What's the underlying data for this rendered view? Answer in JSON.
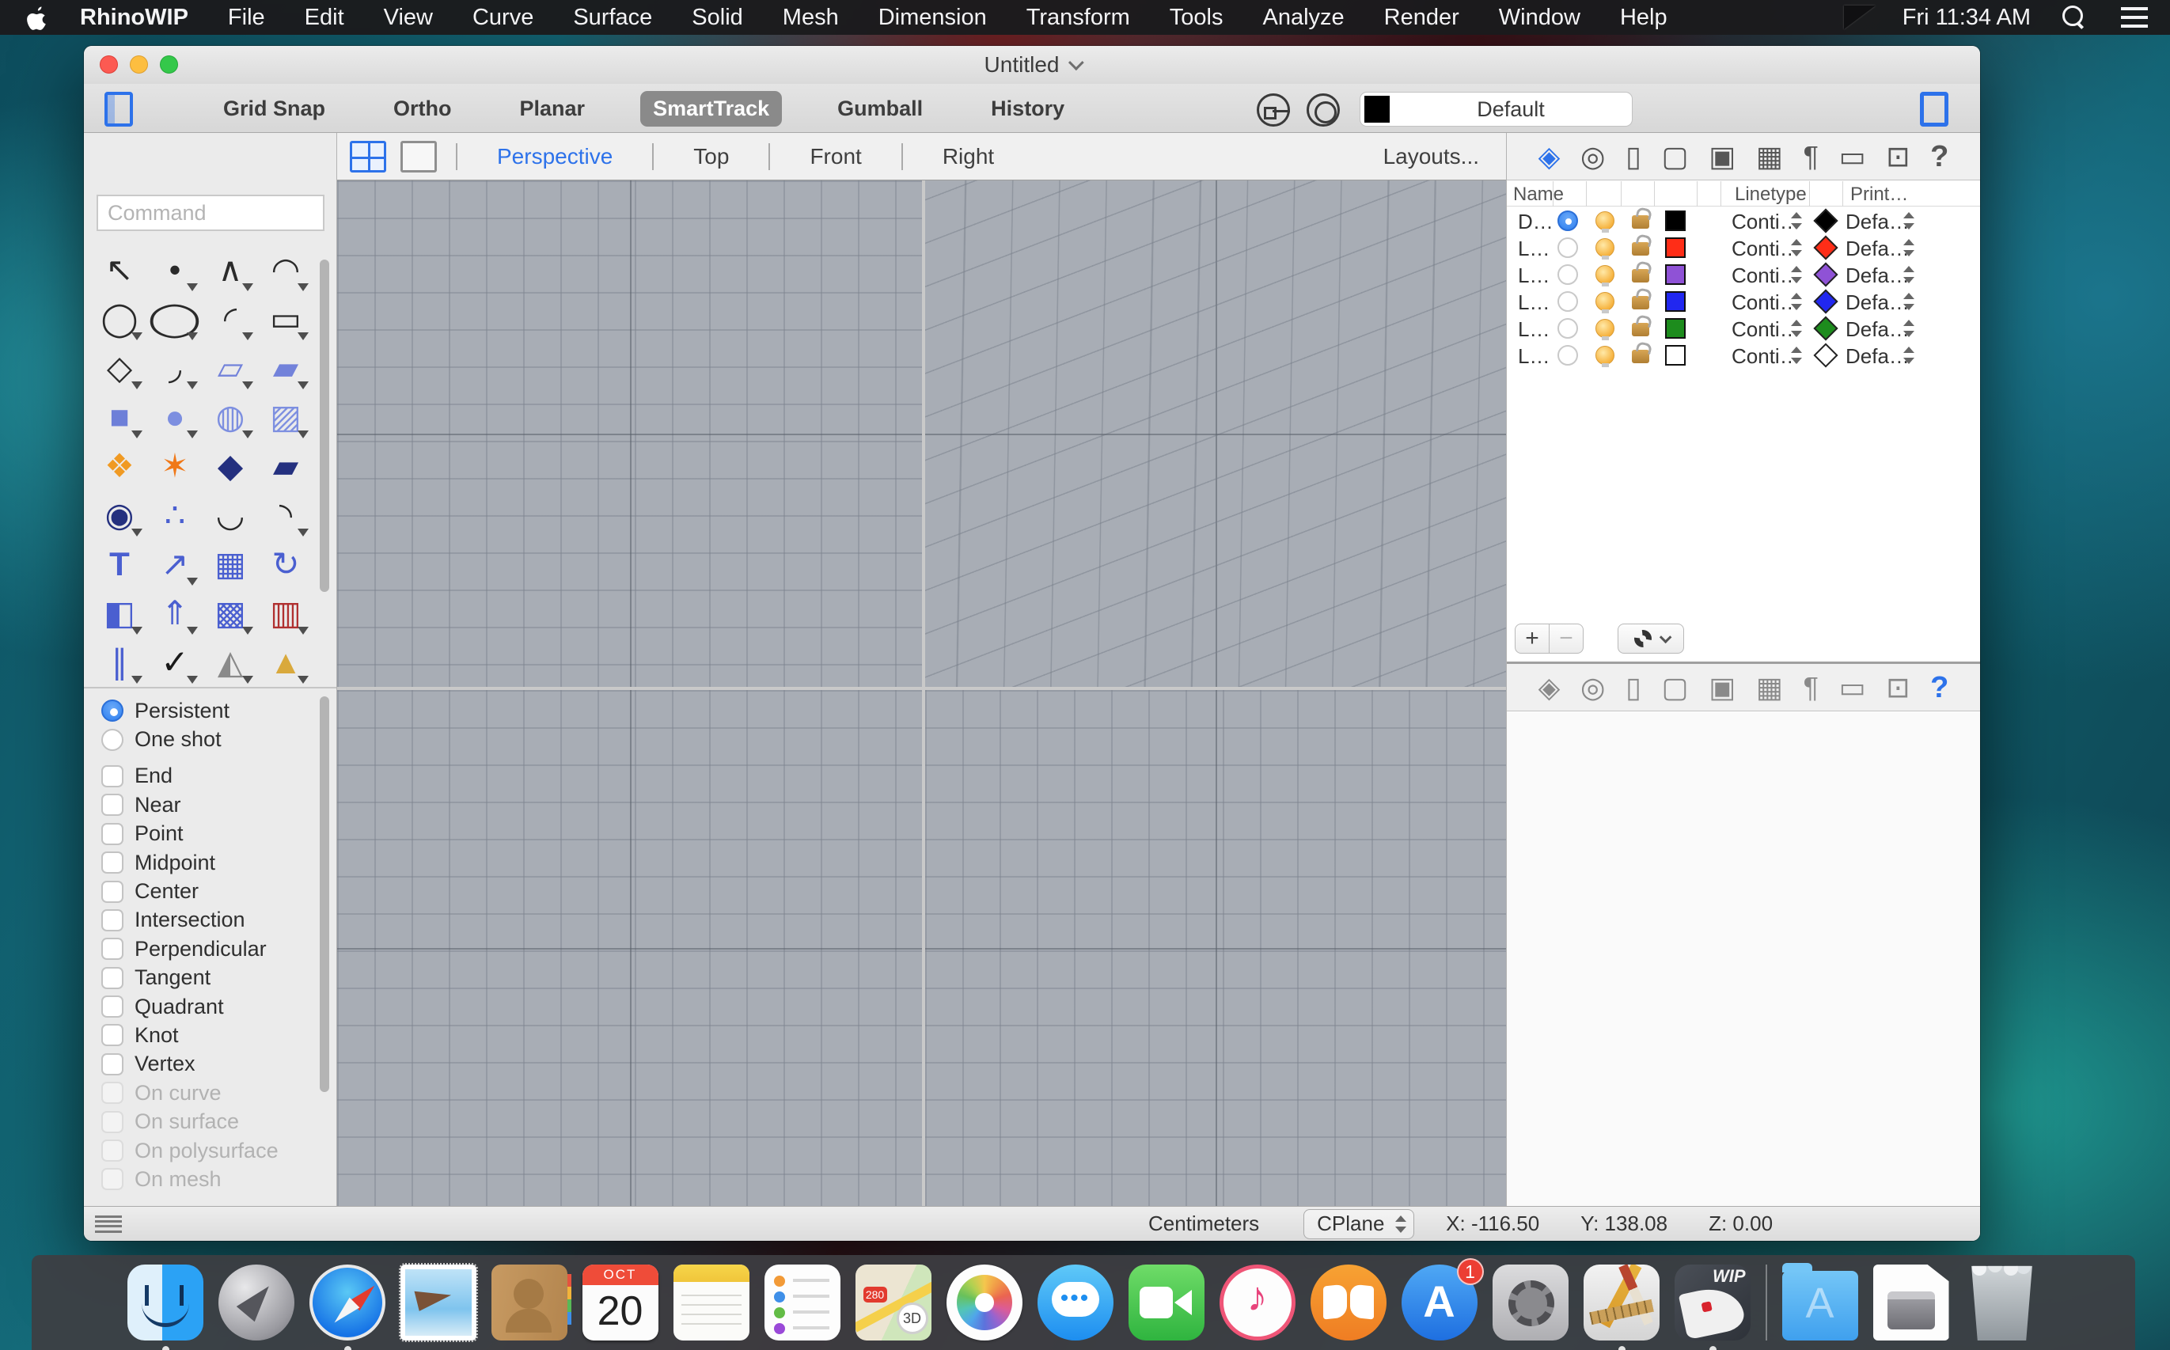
{
  "menubar": {
    "app_name": "RhinoWIP",
    "items": [
      "File",
      "Edit",
      "View",
      "Curve",
      "Surface",
      "Solid",
      "Mesh",
      "Dimension",
      "Transform",
      "Tools",
      "Analyze",
      "Render",
      "Window",
      "Help"
    ],
    "clock": "Fri 11:34 AM"
  },
  "window": {
    "title": "Untitled",
    "toolbar": {
      "toggles": [
        {
          "label": "Grid Snap",
          "active": false
        },
        {
          "label": "Ortho",
          "active": false
        },
        {
          "label": "Planar",
          "active": false
        },
        {
          "label": "SmartTrack",
          "active": true
        },
        {
          "label": "Gumball",
          "active": false
        },
        {
          "label": "History",
          "active": false
        }
      ],
      "display_mode": "Default",
      "display_swatch_color": "#000000"
    }
  },
  "sidebar": {
    "command_placeholder": "Command",
    "tools": [
      {
        "name": "select",
        "glyph": "↖",
        "color": "#2a2a2a",
        "caret": false
      },
      {
        "name": "point",
        "glyph": "•",
        "color": "#2a2a2a",
        "caret": true
      },
      {
        "name": "control-point-curve",
        "glyph": "∧",
        "color": "#2a2a2a",
        "caret": true
      },
      {
        "name": "curve-through-points",
        "glyph": "◠",
        "color": "#2a2a2a",
        "caret": true
      },
      {
        "name": "circle",
        "glyph": "◯",
        "color": "#2a2a2a",
        "caret": true
      },
      {
        "name": "ellipse",
        "glyph": "◯",
        "color": "#2a2a2a",
        "caret": true,
        "wide": true
      },
      {
        "name": "arc",
        "glyph": "◜",
        "color": "#2a2a2a",
        "caret": true
      },
      {
        "name": "rectangle",
        "glyph": "▭",
        "color": "#2a2a2a",
        "caret": true
      },
      {
        "name": "polygon",
        "glyph": "◇",
        "color": "#2a2a2a",
        "caret": true
      },
      {
        "name": "curve-fillet",
        "glyph": "◞",
        "color": "#2a2a2a",
        "caret": true
      },
      {
        "name": "surface-3pt",
        "glyph": "▱",
        "color": "#7282da",
        "caret": true
      },
      {
        "name": "surface-bend",
        "glyph": "▰",
        "color": "#7282da",
        "caret": true
      },
      {
        "name": "box",
        "glyph": "■",
        "color": "#6d7fd8",
        "caret": true
      },
      {
        "name": "sphere",
        "glyph": "●",
        "color": "#7d8fe0",
        "caret": true
      },
      {
        "name": "revolve",
        "glyph": "◍",
        "color": "#7d8fe0",
        "caret": true
      },
      {
        "name": "surface-grid",
        "glyph": "▨",
        "color": "#7d8fe0",
        "caret": true
      },
      {
        "name": "boolean-union",
        "glyph": "❖",
        "color": "#f09a23",
        "caret": false
      },
      {
        "name": "explode",
        "glyph": "✶",
        "color": "#f07818",
        "caret": false
      },
      {
        "name": "fillet-edge",
        "glyph": "◆",
        "color": "#24307f",
        "caret": false
      },
      {
        "name": "chamfer-edge",
        "glyph": "▰",
        "color": "#24307f",
        "caret": false
      },
      {
        "name": "boolean-difference",
        "glyph": "◉",
        "color": "#24307f",
        "caret": true
      },
      {
        "name": "point-cloud",
        "glyph": "∴",
        "color": "#4a5fd0",
        "caret": false
      },
      {
        "name": "blend-curve",
        "glyph": "◡",
        "color": "#2a2a2a",
        "caret": false
      },
      {
        "name": "adjustable-blend",
        "glyph": "◝",
        "color": "#2a2a2a",
        "caret": true
      },
      {
        "name": "text",
        "glyph": "T",
        "color": "#4a5fd0",
        "caret": false
      },
      {
        "name": "scale",
        "glyph": "↗",
        "color": "#4a5fd0",
        "caret": true
      },
      {
        "name": "align",
        "glyph": "▦",
        "color": "#4a5fd0",
        "caret": false
      },
      {
        "name": "orient",
        "glyph": "↻",
        "color": "#4a5fd0",
        "caret": false
      },
      {
        "name": "solid-edit",
        "glyph": "◧",
        "color": "#4a5fd0",
        "caret": true
      },
      {
        "name": "extrude",
        "glyph": "⇑",
        "color": "#4a5fd0",
        "caret": true
      },
      {
        "name": "array",
        "glyph": "▩",
        "color": "#4a5fd0",
        "caret": true
      },
      {
        "name": "array-linear",
        "glyph": "▥",
        "color": "#b03030",
        "caret": true
      },
      {
        "name": "offset",
        "glyph": "∥",
        "color": "#4a5fd0",
        "caret": true
      },
      {
        "name": "check",
        "glyph": "✓",
        "color": "#1a1a1a",
        "caret": true
      },
      {
        "name": "primitives",
        "glyph": "◭",
        "color": "#8a8a8a",
        "caret": true
      },
      {
        "name": "pyramid-hide",
        "glyph": "▲",
        "color": "#d9a93c",
        "caret": true
      },
      {
        "name": "circle-add",
        "glyph": "⊕",
        "color": "#2a2a2a",
        "caret": false
      },
      {
        "name": "circle-dashed",
        "glyph": "◌",
        "color": "#2a2a2a",
        "caret": false
      },
      {
        "name": "circle-capture",
        "glyph": "◎",
        "color": "#2a2a2a",
        "caret": false
      },
      {
        "name": "circle-plain",
        "glyph": "○",
        "color": "#2a2a2a",
        "caret": false
      }
    ],
    "osnap": [
      {
        "label": "Persistent",
        "type": "radio",
        "checked": true
      },
      {
        "label": "One shot",
        "type": "radio",
        "checked": false
      },
      {
        "label": "End",
        "type": "checkbox",
        "checked": false,
        "gap": true
      },
      {
        "label": "Near",
        "type": "checkbox",
        "checked": false
      },
      {
        "label": "Point",
        "type": "checkbox",
        "checked": false
      },
      {
        "label": "Midpoint",
        "type": "checkbox",
        "checked": false
      },
      {
        "label": "Center",
        "type": "checkbox",
        "checked": false
      },
      {
        "label": "Intersection",
        "type": "checkbox",
        "checked": false
      },
      {
        "label": "Perpendicular",
        "type": "checkbox",
        "checked": false
      },
      {
        "label": "Tangent",
        "type": "checkbox",
        "checked": false
      },
      {
        "label": "Quadrant",
        "type": "checkbox",
        "checked": false
      },
      {
        "label": "Knot",
        "type": "checkbox",
        "checked": false
      },
      {
        "label": "Vertex",
        "type": "checkbox",
        "checked": false
      },
      {
        "label": "On curve",
        "type": "checkbox",
        "checked": false,
        "disabled": true
      },
      {
        "label": "On surface",
        "type": "checkbox",
        "checked": false,
        "disabled": true
      },
      {
        "label": "On polysurface",
        "type": "checkbox",
        "checked": false,
        "disabled": true
      },
      {
        "label": "On mesh",
        "type": "checkbox",
        "checked": false,
        "disabled": true
      }
    ]
  },
  "viewport": {
    "tabs": [
      "Perspective",
      "Top",
      "Front",
      "Right"
    ],
    "active_tab": "Perspective",
    "layouts_label": "Layouts...",
    "panes": [
      {
        "name": "top",
        "axes": [
          "y",
          "x"
        ]
      },
      {
        "name": "perspective",
        "axes": [
          "z",
          "y",
          "x"
        ]
      },
      {
        "name": "front",
        "axes": [
          "z",
          "x"
        ]
      },
      {
        "name": "right",
        "axes": [
          "z",
          "y"
        ]
      }
    ]
  },
  "layers_panel": {
    "tabs": [
      {
        "name": "layers",
        "glyph": "◈"
      },
      {
        "name": "materials",
        "glyph": "◎"
      },
      {
        "name": "file",
        "glyph": "▯"
      },
      {
        "name": "rendering",
        "glyph": "▢"
      },
      {
        "name": "named-views",
        "glyph": "▣"
      },
      {
        "name": "cplanes",
        "glyph": "▦"
      },
      {
        "name": "notes",
        "glyph": "¶"
      },
      {
        "name": "layouts",
        "glyph": "▭"
      },
      {
        "name": "display",
        "glyph": "⊡"
      },
      {
        "name": "help",
        "glyph": "?"
      }
    ],
    "top_strip_active": "layers",
    "bottom_strip_active": "help",
    "columns": [
      "Name",
      "Linetype",
      "Print…"
    ],
    "rows": [
      {
        "name": "D…",
        "current": true,
        "color": "#000000",
        "linetype": "Conti…",
        "print": "Defa…"
      },
      {
        "name": "L…",
        "current": false,
        "color": "#ff2d17",
        "linetype": "Conti…",
        "print": "Defa…"
      },
      {
        "name": "L…",
        "current": false,
        "color": "#8f52d6",
        "linetype": "Conti…",
        "print": "Defa…"
      },
      {
        "name": "L…",
        "current": false,
        "color": "#2127f0",
        "linetype": "Conti…",
        "print": "Defa…"
      },
      {
        "name": "L…",
        "current": false,
        "color": "#1d8c1d",
        "linetype": "Conti…",
        "print": "Defa…"
      },
      {
        "name": "L…",
        "current": false,
        "color": "#ffffff",
        "linetype": "Conti…",
        "print": "Defa…"
      }
    ],
    "footer": {
      "add": "+",
      "remove": "−"
    }
  },
  "statusbar": {
    "units": "Centimeters",
    "cplane": "CPlane",
    "x": "X: -116.50",
    "y": "Y: 138.08",
    "z": "Z: 0.00"
  },
  "dock": {
    "items": [
      {
        "icon": "finder",
        "running": true
      },
      {
        "icon": "launchpad"
      },
      {
        "icon": "safari",
        "running": true
      },
      {
        "icon": "mail"
      },
      {
        "icon": "contacts"
      },
      {
        "icon": "calendar",
        "month": "OCT",
        "day": "20"
      },
      {
        "icon": "notes"
      },
      {
        "icon": "reminders"
      },
      {
        "icon": "maps",
        "shield": "280",
        "mode": "3D"
      },
      {
        "icon": "photos"
      },
      {
        "icon": "messages"
      },
      {
        "icon": "facetime"
      },
      {
        "icon": "itunes",
        "note": "♪"
      },
      {
        "icon": "ibooks"
      },
      {
        "icon": "appstore",
        "badge": "1"
      },
      {
        "icon": "system-preferences"
      },
      {
        "icon": "generic-app",
        "running": true
      },
      {
        "icon": "rhinowip",
        "label": "WIP",
        "running": true
      },
      {
        "icon": "divider"
      },
      {
        "icon": "applications-folder"
      },
      {
        "icon": "disk-image"
      },
      {
        "icon": "trash"
      }
    ]
  }
}
